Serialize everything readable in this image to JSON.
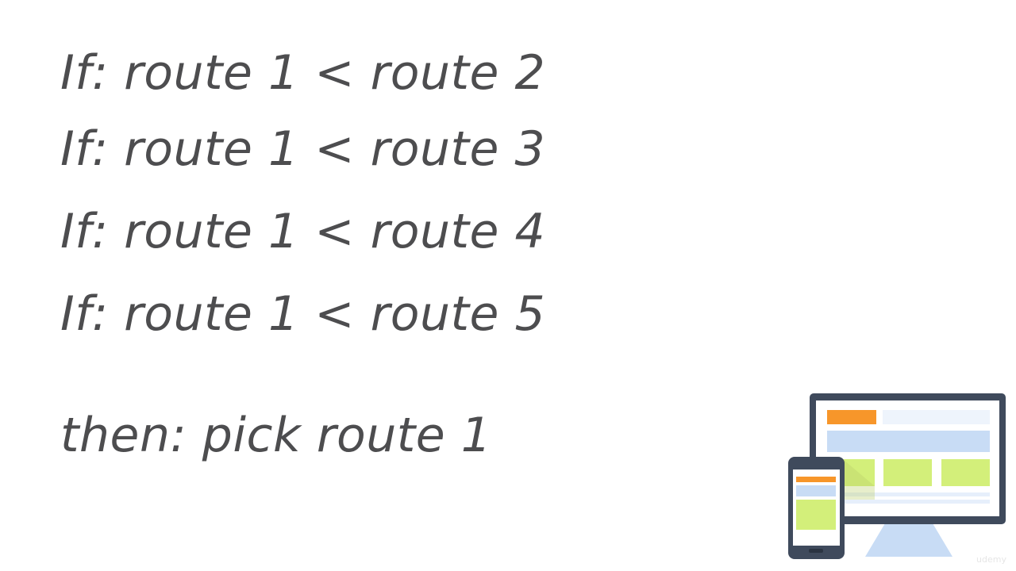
{
  "slide": {
    "lines": [
      "If: route 1 < route 2",
      "If: route 1 < route 3",
      "If: route 1 < route 4",
      "If: route 1 < route 5",
      "then: pick route 1"
    ],
    "text_color": "#4d4d4f",
    "watermark": "udemy"
  },
  "illustration": {
    "icon": "responsive-devices-icon",
    "frame_color": "#3f4a5c",
    "accent_orange": "#f7962a",
    "accent_blue": "#c8dcf5",
    "accent_green": "#d3ef7a"
  }
}
